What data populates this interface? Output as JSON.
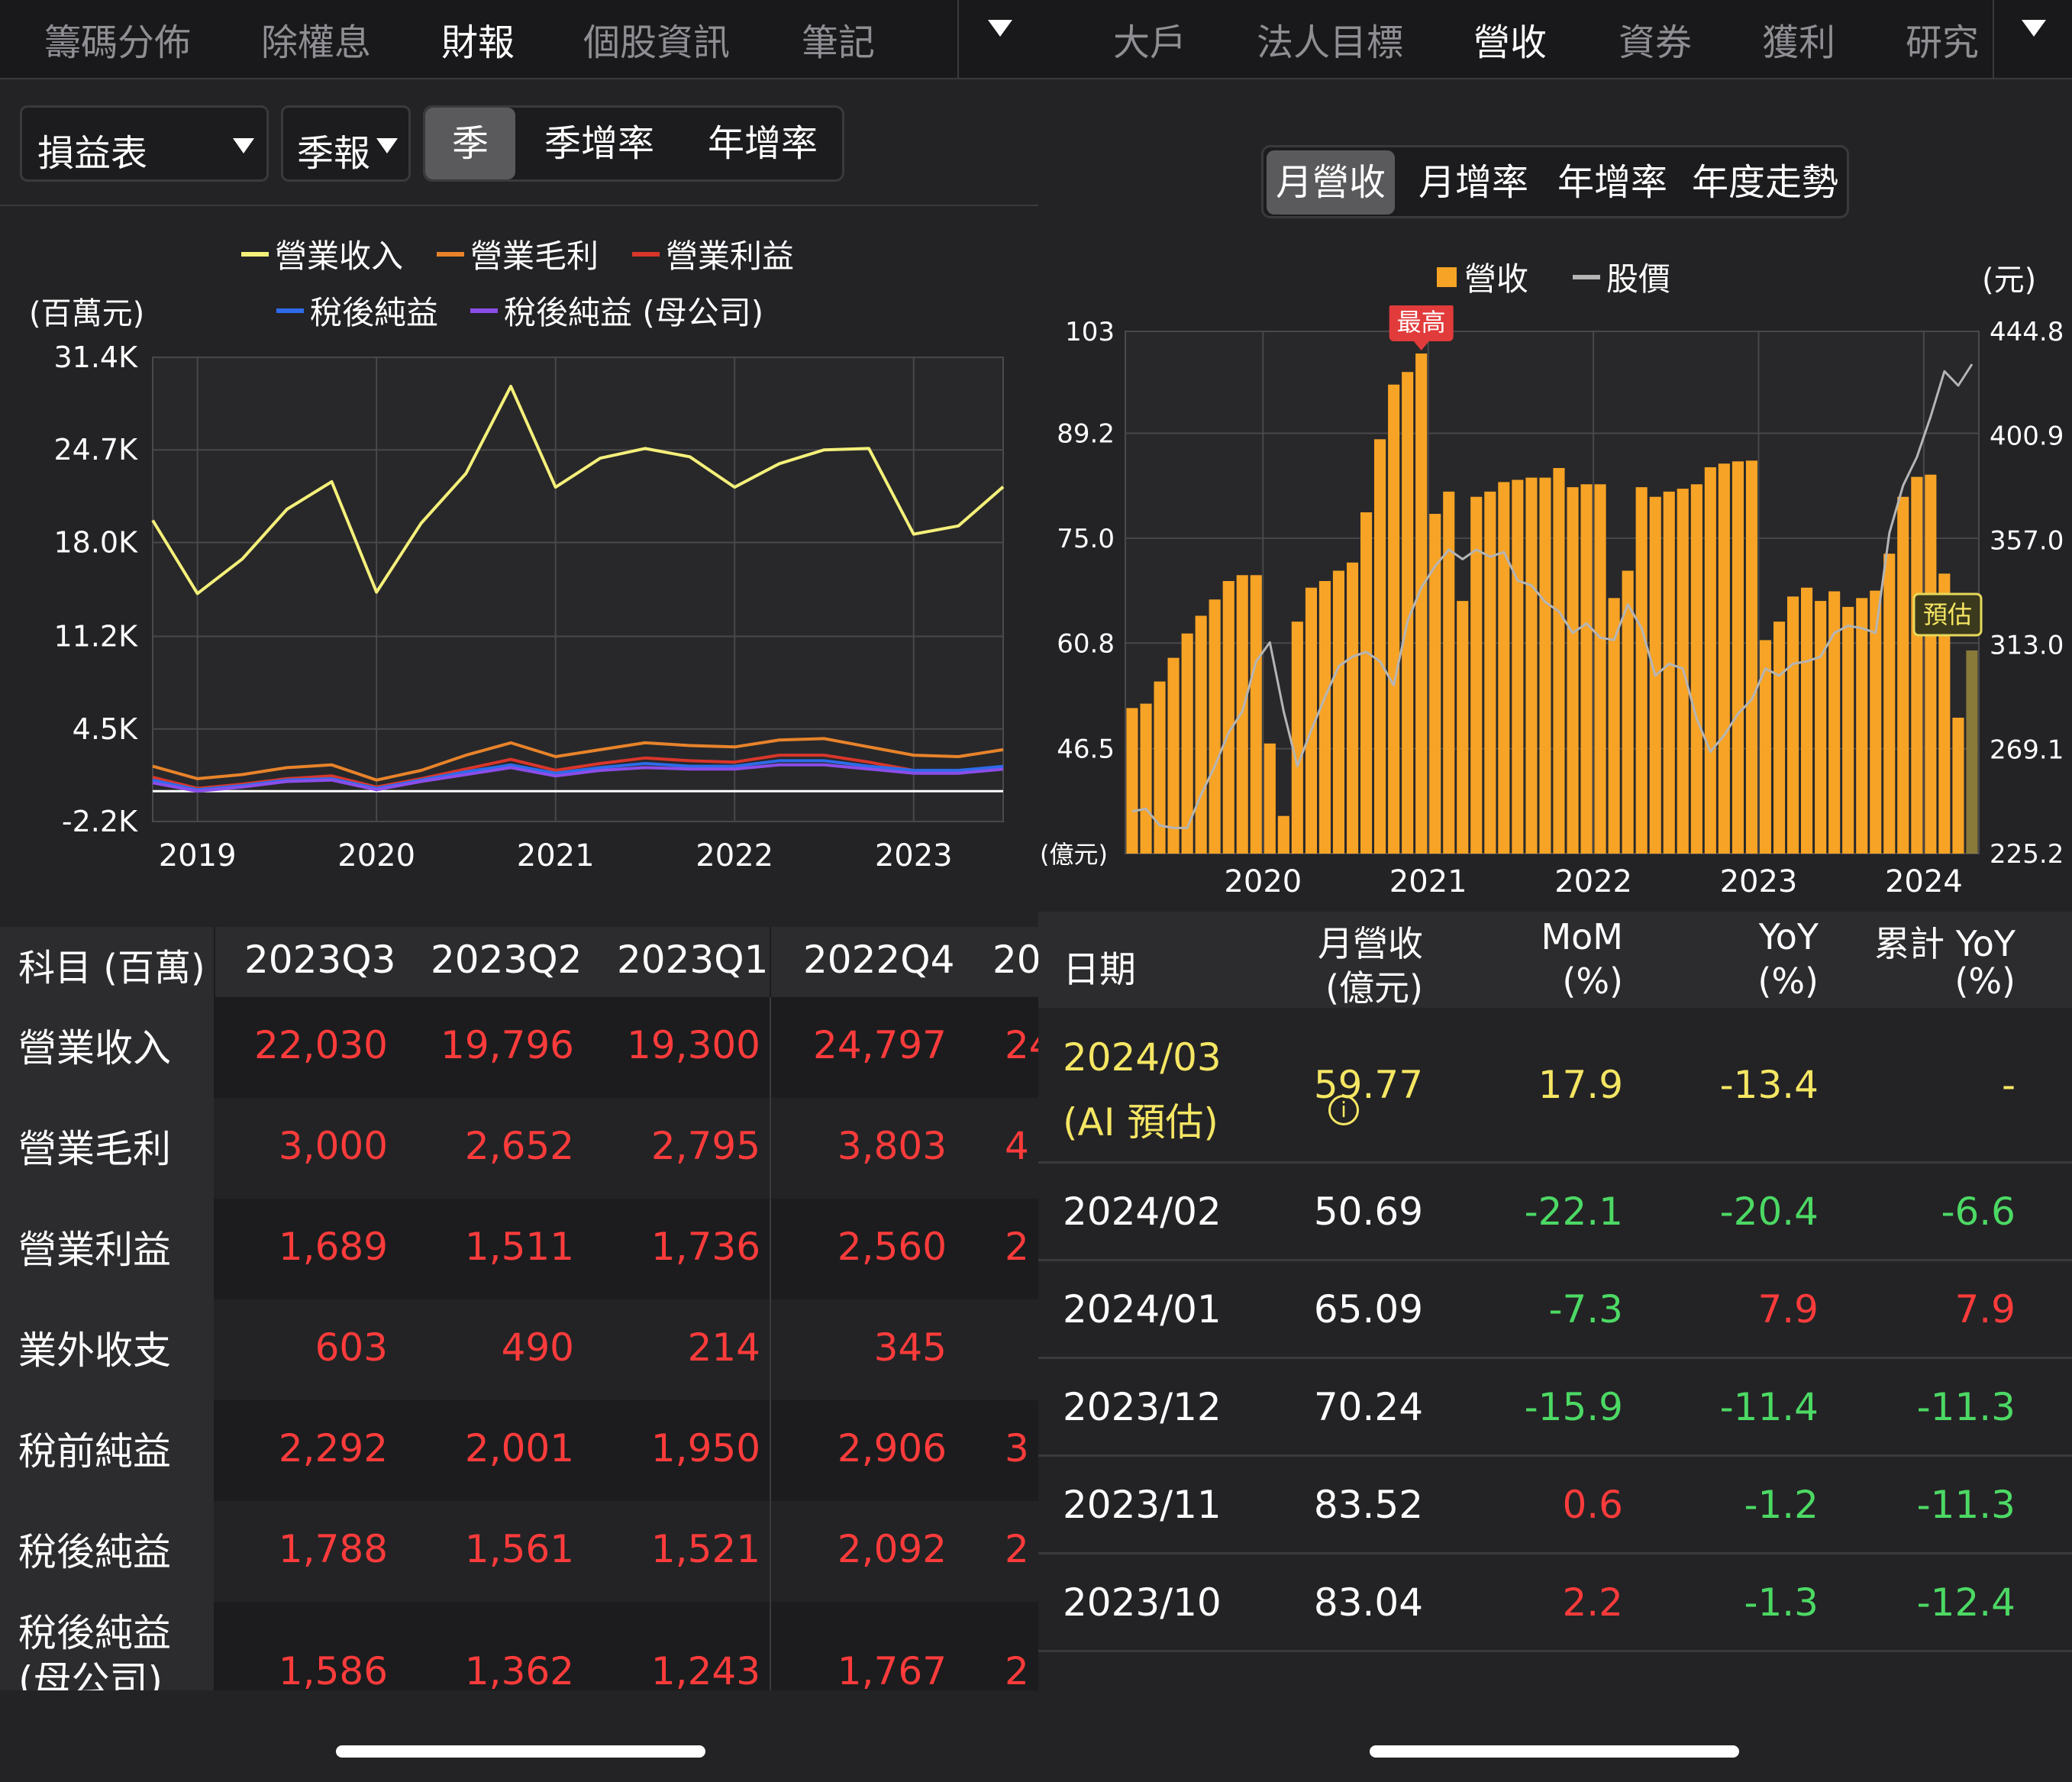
{
  "left": {
    "tabs": [
      "籌碼分佈",
      "除權息",
      "財報",
      "個股資訊",
      "筆記"
    ],
    "active_tab": 2,
    "statement_dropdown": "損益表",
    "period_dropdown": "季報",
    "segments": [
      "季",
      "季增率",
      "年增率"
    ],
    "active_segment": 0,
    "unit_label": "(百萬元)",
    "table_header": [
      "科目 (百萬)",
      "2023Q3",
      "2023Q2",
      "2023Q1",
      "2022Q4",
      "20"
    ],
    "table_rows": [
      {
        "label": "營業收入",
        "values": [
          "22,030",
          "19,796",
          "19,300",
          "24,797",
          "24"
        ]
      },
      {
        "label": "營業毛利",
        "values": [
          "3,000",
          "2,652",
          "2,795",
          "3,803",
          "4"
        ]
      },
      {
        "label": "營業利益",
        "values": [
          "1,689",
          "1,511",
          "1,736",
          "2,560",
          "2"
        ]
      },
      {
        "label": "業外收支",
        "values": [
          "603",
          "490",
          "214",
          "345",
          ""
        ]
      },
      {
        "label": "稅前純益",
        "values": [
          "2,292",
          "2,001",
          "1,950",
          "2,906",
          "3"
        ]
      },
      {
        "label": "稅後純益",
        "values": [
          "1,788",
          "1,561",
          "1,521",
          "2,092",
          "2"
        ]
      },
      {
        "label": "稅後純益\n(母公司)",
        "values": [
          "1,586",
          "1,362",
          "1,243",
          "1,767",
          "2"
        ]
      }
    ]
  },
  "right": {
    "tabs": [
      "大戶",
      "法人目標",
      "營收",
      "資券",
      "獲利",
      "研究"
    ],
    "active_tab": 2,
    "segments": [
      "月營收",
      "月增率",
      "年增率",
      "年度走勢"
    ],
    "active_segment": 0,
    "left_unit": "(億元)",
    "right_unit": "(元)",
    "high_badge": "最高",
    "estimate_badge": "預估",
    "table_header": {
      "date": "日期",
      "rev": [
        "月營收",
        "(億元)"
      ],
      "mom": [
        "MoM",
        "(%)"
      ],
      "yoy": [
        "YoY",
        "(%)"
      ],
      "cum": [
        "累計 YoY",
        "(%)"
      ]
    },
    "table_rows": [
      {
        "date": "2024/03",
        "date2": "(AI 預估)",
        "rev": "59.77",
        "mom": "17.9",
        "yoy": "-13.4",
        "cum": "-",
        "estimate": true
      },
      {
        "date": "2024/02",
        "rev": "50.69",
        "mom": "-22.1",
        "yoy": "-20.4",
        "cum": "-6.6"
      },
      {
        "date": "2024/01",
        "rev": "65.09",
        "mom": "-7.3",
        "yoy": "7.9",
        "cum": "7.9"
      },
      {
        "date": "2023/12",
        "rev": "70.24",
        "mom": "-15.9",
        "yoy": "-11.4",
        "cum": "-11.3"
      },
      {
        "date": "2023/11",
        "rev": "83.52",
        "mom": "0.6",
        "yoy": "-1.2",
        "cum": "-11.3"
      },
      {
        "date": "2023/10",
        "rev": "83.04",
        "mom": "2.2",
        "yoy": "-1.3",
        "cum": "-12.4"
      }
    ]
  },
  "chart_data": [
    {
      "type": "line",
      "ylabel": "(百萬元)",
      "ylim": [
        -2200,
        31400
      ],
      "yticks": [
        "31.4K",
        "24.7K",
        "18.0K",
        "11.2K",
        "4.5K",
        "-2.2K"
      ],
      "ytick_values": [
        31400,
        24700,
        18000,
        11200,
        4500,
        -2200
      ],
      "xtick_labels": [
        "2019",
        "2020",
        "2021",
        "2022",
        "2023"
      ],
      "xtick_index": [
        1,
        5,
        9,
        13,
        17
      ],
      "legend_placement": "top",
      "grid": true,
      "series": [
        {
          "name": "營業收入",
          "color": "#f5f07a",
          "values": [
            19600,
            14300,
            16800,
            20400,
            22400,
            14400,
            19400,
            23000,
            29300,
            22000,
            24100,
            24800,
            24200,
            22000,
            23700,
            24700,
            24800,
            18600,
            19200,
            22030
          ]
        },
        {
          "name": "營業毛利",
          "color": "#e8832a",
          "values": [
            1800,
            900,
            1200,
            1700,
            1900,
            800,
            1500,
            2600,
            3500,
            2500,
            3000,
            3500,
            3300,
            3200,
            3700,
            3800,
            3200,
            2600,
            2500,
            3000
          ]
        },
        {
          "name": "營業利益",
          "color": "#d9362b",
          "values": [
            1000,
            200,
            500,
            900,
            1100,
            300,
            900,
            1600,
            2300,
            1500,
            2000,
            2400,
            2200,
            2100,
            2600,
            2600,
            2100,
            1500,
            1500,
            1689
          ]
        },
        {
          "name": "稅後純益",
          "color": "#2d6bea",
          "values": [
            800,
            100,
            400,
            800,
            900,
            200,
            800,
            1400,
            1900,
            1300,
            1700,
            2000,
            1800,
            1800,
            2200,
            2200,
            1800,
            1500,
            1500,
            1788
          ]
        },
        {
          "name": "稅後純益 (母公司)",
          "color": "#8a4de8",
          "values": [
            600,
            0,
            300,
            700,
            800,
            100,
            700,
            1200,
            1700,
            1100,
            1500,
            1700,
            1600,
            1600,
            1900,
            1900,
            1600,
            1300,
            1300,
            1586
          ]
        }
      ]
    },
    {
      "type": "bar",
      "ylabel": "(億元)",
      "ylim": [
        32.3,
        103
      ],
      "yticks": [
        "103",
        "89.2",
        "75.0",
        "60.8",
        "46.5"
      ],
      "ytick_values": [
        103,
        89.2,
        75.0,
        60.8,
        46.5
      ],
      "y2lim": [
        225.2,
        444.8
      ],
      "y2ticks": [
        "444.8",
        "400.9",
        "357.0",
        "313.0",
        "269.1",
        "225.2"
      ],
      "y2tick_values": [
        444.8,
        400.9,
        357.0,
        313.0,
        269.1,
        225.2
      ],
      "xtick_labels": [
        "2020",
        "2021",
        "2022",
        "2023",
        "2024"
      ],
      "xtick_index": [
        10,
        22,
        34,
        46,
        58
      ],
      "legend_placement": "top",
      "grid": true,
      "series": [
        {
          "name": "營收",
          "color": "#f7a325",
          "values": [
            52.0,
            52.6,
            55.6,
            58.8,
            62.1,
            64.5,
            66.7,
            69.2,
            70.0,
            70.0,
            47.2,
            37.4,
            63.7,
            68.3,
            69.2,
            70.6,
            71.7,
            78.5,
            88.4,
            95.8,
            97.5,
            100.0,
            78.3,
            81.3,
            66.5,
            80.6,
            81.3,
            82.6,
            82.9,
            83.2,
            83.2,
            84.5,
            81.9,
            82.3,
            82.3,
            66.9,
            70.6,
            81.9,
            80.6,
            81.3,
            81.7,
            82.3,
            84.6,
            85.1,
            85.4,
            85.5,
            61.2,
            63.7,
            67.1,
            68.3,
            66.5,
            67.8,
            65.7,
            66.9,
            67.9,
            72.9,
            80.6,
            83.3,
            83.6,
            70.2,
            50.7,
            59.8
          ]
        },
        {
          "name": "股價",
          "color": "#b5b5b5",
          "values": [
            243,
            244,
            237,
            236,
            236,
            250,
            262,
            276,
            285,
            306,
            314,
            285,
            262,
            277,
            291,
            304,
            308,
            310,
            306,
            296,
            323,
            337,
            346,
            353,
            349,
            353,
            350,
            352,
            340,
            338,
            331,
            327,
            318,
            322,
            316,
            315,
            330,
            320,
            300,
            305,
            303,
            282,
            268,
            275,
            284,
            290,
            303,
            300,
            305,
            306,
            308,
            318,
            321,
            320,
            318,
            360,
            380,
            392,
            409,
            428,
            422,
            431
          ]
        }
      ],
      "estimate_index": 61
    }
  ]
}
